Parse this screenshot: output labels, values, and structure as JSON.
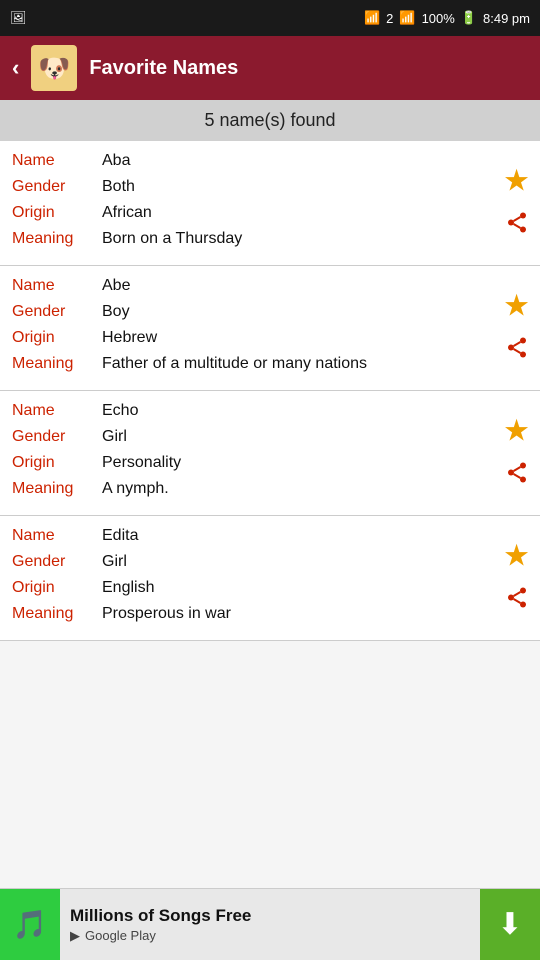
{
  "statusBar": {
    "time": "8:49 pm",
    "battery": "100%",
    "signal": "▲"
  },
  "header": {
    "title": "Favorite Names",
    "logoEmoji": "🐶"
  },
  "countBar": {
    "text": "5 name(s) found"
  },
  "entries": [
    {
      "name": "Aba",
      "gender": "Both",
      "origin": "African",
      "meaning": "Born on a Thursday",
      "hasStar": true,
      "hasShare": true
    },
    {
      "name": "Abe",
      "gender": "Boy",
      "origin": "Hebrew",
      "meaning": "Father of a multitude or many nations",
      "hasStar": true,
      "hasShare": true
    },
    {
      "name": "Echo",
      "gender": "Girl",
      "origin": "Personality",
      "meaning": "A nymph.",
      "hasStar": true,
      "hasShare": true
    },
    {
      "name": "Edita",
      "gender": "Girl",
      "origin": "English",
      "meaning": "Prosperous in war",
      "hasStar": true,
      "hasShare": true
    }
  ],
  "labels": {
    "name": "Name",
    "gender": "Gender",
    "origin": "Origin",
    "meaning": "Meaning"
  },
  "ad": {
    "title": "Millions of Songs Free",
    "subtitle": "Google Play",
    "logoEmoji": "🎵"
  }
}
